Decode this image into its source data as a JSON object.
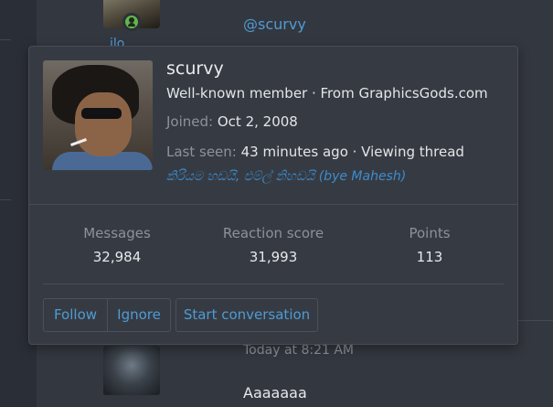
{
  "background_post": {
    "mention": "@scurvy",
    "partial_name": "_ilo",
    "time": "Today at 8:21 AM",
    "message": "Aaaaaaa"
  },
  "member_card": {
    "username": "scurvy",
    "user_title": "Well-known member · From GraphicsGods.com",
    "joined_label": "Joined:",
    "joined_value": "Oct 2, 2008",
    "last_seen_label": "Last seen:",
    "last_seen_value": "43 minutes ago · Viewing thread",
    "signature": "කිරියම හඩයි, එම්ල් නිහඩයි (bye Mahesh)",
    "stats": [
      {
        "label": "Messages",
        "value": "32,984"
      },
      {
        "label": "Reaction score",
        "value": "31,993"
      },
      {
        "label": "Points",
        "value": "113"
      }
    ],
    "buttons": {
      "follow": "Follow",
      "ignore": "Ignore",
      "start_conversation": "Start conversation"
    }
  },
  "colors": {
    "link": "#4f9bd4",
    "online": "#63b44f",
    "card_bg": "#363b43"
  }
}
